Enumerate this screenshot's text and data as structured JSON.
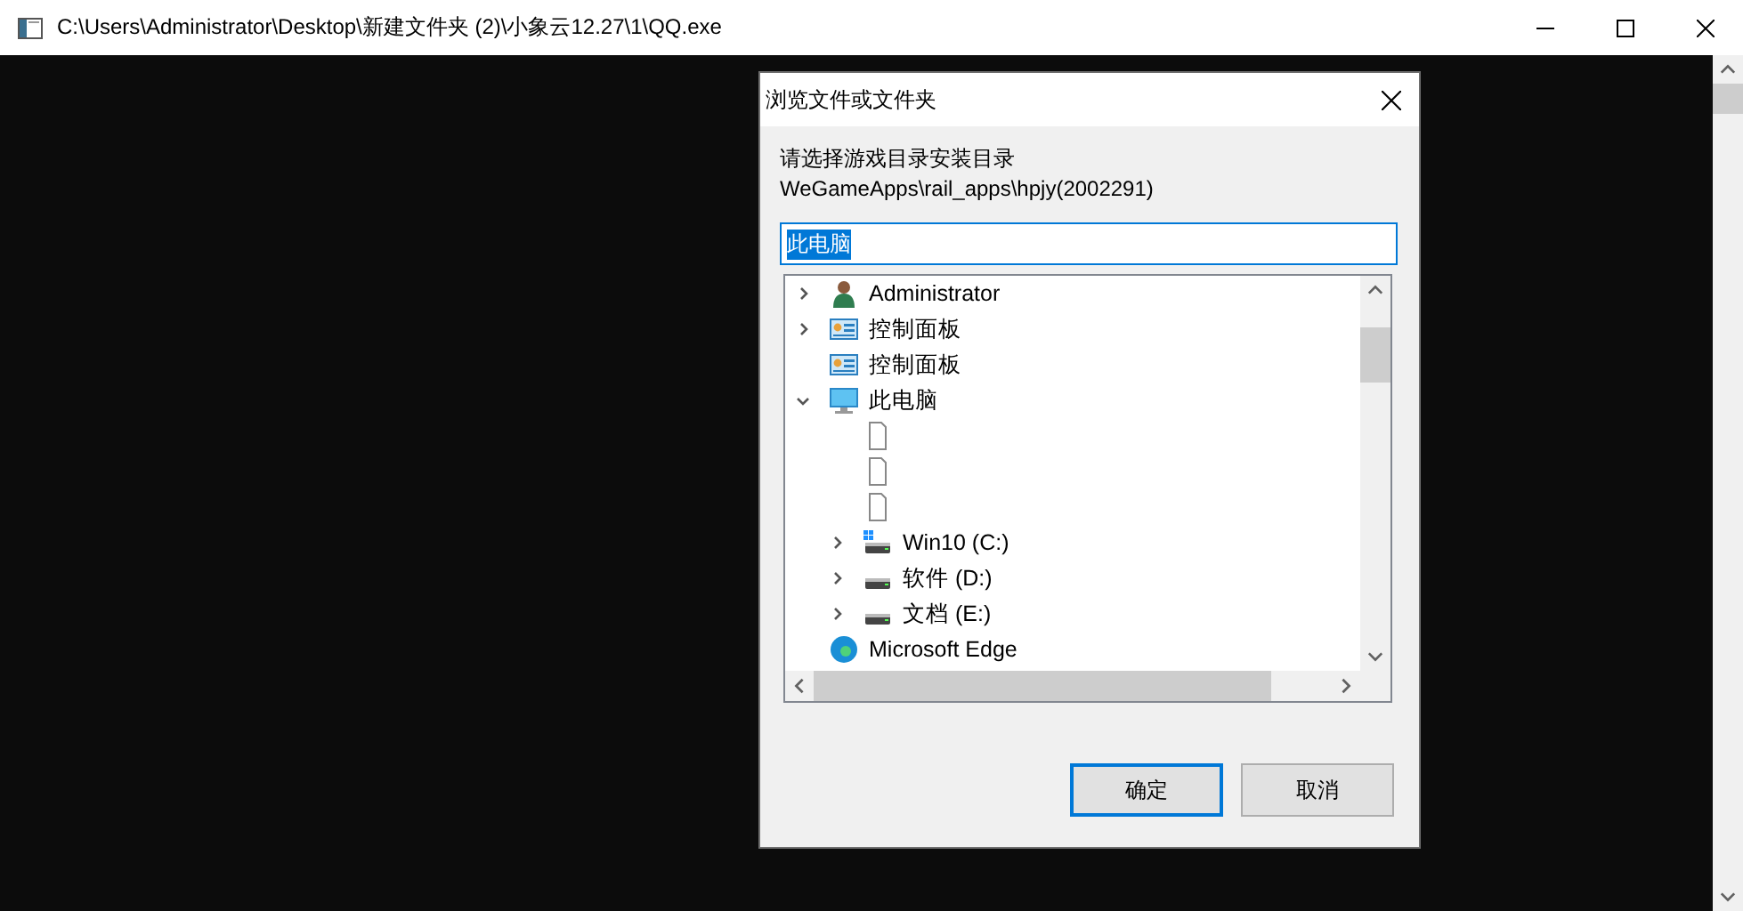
{
  "window": {
    "title": "C:\\Users\\Administrator\\Desktop\\新建文件夹 (2)\\小象云12.27\\1\\QQ.exe"
  },
  "dialog": {
    "title": "浏览文件或文件夹",
    "instruction": "请选择游戏目录安装目录",
    "path": "WeGameApps\\rail_apps\\hpjy(2002291)",
    "folder_field": {
      "value": "此电脑",
      "selected": true
    },
    "tree": [
      {
        "kind": "user",
        "label": "Administrator",
        "expandable": true,
        "expanded": false
      },
      {
        "kind": "control-panel",
        "label": "控制面板",
        "expandable": true,
        "expanded": false
      },
      {
        "kind": "control-panel",
        "label": "控制面板",
        "expandable": false
      },
      {
        "kind": "computer",
        "label": "此电脑",
        "expandable": true,
        "expanded": true,
        "children": [
          {
            "kind": "file",
            "expandable": false
          },
          {
            "kind": "file",
            "expandable": false
          },
          {
            "kind": "file",
            "expandable": false
          },
          {
            "kind": "system-drive",
            "label": "Win10 (C:)",
            "expandable": true,
            "expanded": false
          },
          {
            "kind": "drive",
            "label": "软件 (D:)",
            "expandable": true,
            "expanded": false
          },
          {
            "kind": "drive",
            "label": "文档 (E:)",
            "expandable": true,
            "expanded": false
          }
        ]
      },
      {
        "kind": "edge",
        "label": "Microsoft Edge",
        "expandable": false
      }
    ],
    "buttons": [
      {
        "label": "确定",
        "default": true
      },
      {
        "label": "取消",
        "default": false
      }
    ]
  }
}
